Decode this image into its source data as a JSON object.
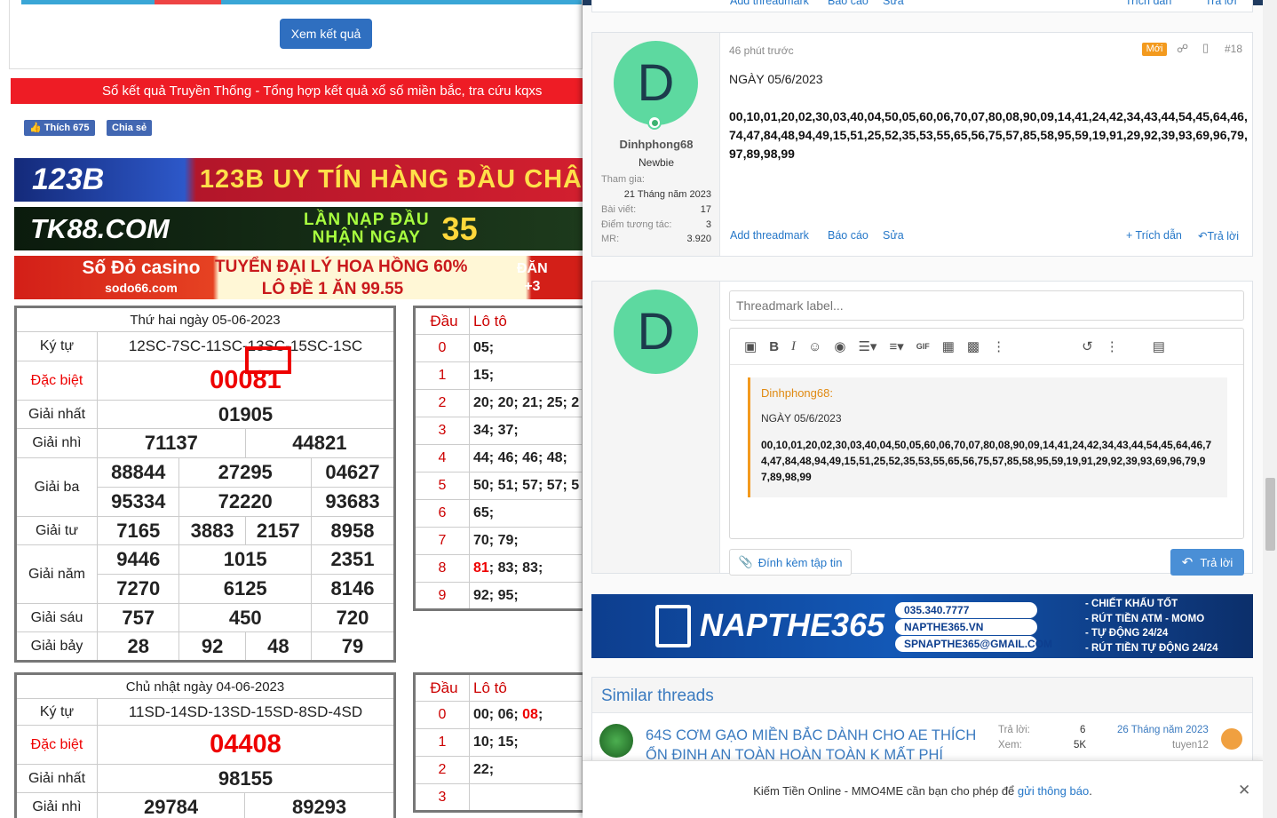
{
  "left": {
    "result_button": "Xem kết quả",
    "red_bar": "Sổ kết quả Truyền Thống - Tổng hợp kết quả xổ số miền bắc, tra cứu kqxs",
    "fb_like": "Thích 675",
    "fb_share": "Chia sẻ",
    "banners": {
      "b1_logo": "123B",
      "b1_text": "123B UY TÍN HÀNG ĐẦU CHÂ",
      "b2_logo": "TK88.COM",
      "b2_line1": "LẦN NẠP ĐẦU",
      "b2_line2": "NHẬN NGAY",
      "b2_big": "35",
      "b3_logo": "Số Đỏ casino",
      "b3_site": "sodo66.com",
      "b3_line1": "TUYỂN ĐẠI LÝ  HOA HỒNG 60%",
      "b3_line2": "LÔ ĐỀ  1 ĂN 99.55",
      "b3_corner1": "ĐĂN",
      "b3_corner2": "+3"
    },
    "tables": [
      {
        "header": "Thứ hai ngày 05-06-2023",
        "labels": {
          "ky_tu": "Ký tự",
          "dac_biet": "Đặc biệt",
          "g1": "Giải nhất",
          "g2": "Giải nhì",
          "g3": "Giải ba",
          "g4": "Giải tư",
          "g5": "Giải năm",
          "g6": "Giải sáu",
          "g7": "Giải bảy"
        },
        "ky_tu": "12SC-7SC-11SC-13SC-15SC-1SC",
        "dac_biet": "00081",
        "g1": "01905",
        "g2": [
          "71137",
          "44821"
        ],
        "g3": [
          "88844",
          "27295",
          "04627",
          "95334",
          "72220",
          "93683"
        ],
        "g4": [
          "7165",
          "3883",
          "2157",
          "8958"
        ],
        "g5": [
          "9446",
          "1015",
          "2351",
          "7270",
          "6125",
          "8146"
        ],
        "g6": [
          "757",
          "450",
          "720"
        ],
        "g7": [
          "28",
          "92",
          "48",
          "79"
        ]
      },
      {
        "header": "Chủ nhật ngày 04-06-2023",
        "labels": {
          "ky_tu": "Ký tự",
          "dac_biet": "Đặc biệt",
          "g1": "Giải nhất",
          "g2": "Giải nhì"
        },
        "ky_tu": "11SD-14SD-13SD-15SD-8SD-4SD",
        "dac_biet": "04408",
        "g1": "98155",
        "g2": [
          "29784",
          "89293"
        ]
      }
    ],
    "loto": [
      {
        "head_label": "Đầu",
        "loto_label": "Lô tô",
        "rows": [
          {
            "dau": "0",
            "pre": "",
            "hl": "",
            "rest": "05;"
          },
          {
            "dau": "1",
            "pre": "",
            "hl": "",
            "rest": "15;"
          },
          {
            "dau": "2",
            "pre": "",
            "hl": "",
            "rest": "20; 20; 21; 25; 2"
          },
          {
            "dau": "3",
            "pre": "",
            "hl": "",
            "rest": "34; 37;"
          },
          {
            "dau": "4",
            "pre": "",
            "hl": "",
            "rest": "44; 46; 46; 48;"
          },
          {
            "dau": "5",
            "pre": "",
            "hl": "",
            "rest": "50; 51; 57; 57; 5"
          },
          {
            "dau": "6",
            "pre": "",
            "hl": "",
            "rest": "65;"
          },
          {
            "dau": "7",
            "pre": "",
            "hl": "",
            "rest": "70; 79;"
          },
          {
            "dau": "8",
            "pre": "",
            "hl": "81",
            "rest": "; 83; 83;"
          },
          {
            "dau": "9",
            "pre": "",
            "hl": "",
            "rest": "92; 95;"
          }
        ]
      },
      {
        "head_label": "Đầu",
        "loto_label": "Lô tô",
        "rows": [
          {
            "dau": "0",
            "pre": "00; 06; ",
            "hl": "08",
            "rest": ";"
          },
          {
            "dau": "1",
            "pre": "",
            "hl": "",
            "rest": "10; 15;"
          },
          {
            "dau": "2",
            "pre": "",
            "hl": "",
            "rest": "22;"
          },
          {
            "dau": "3",
            "pre": "",
            "hl": "",
            "rest": ""
          }
        ]
      }
    ]
  },
  "forum": {
    "prev_actions": {
      "add": "Add threadmark",
      "report": "Báo cáo",
      "edit": "Sửa",
      "quote": "Trích dẫn",
      "reply": "Trả lời"
    },
    "post": {
      "avatar_letter": "D",
      "username": "Dinhphong68",
      "user_title": "Newbie",
      "joined_label": "Tham gia:",
      "joined": "21 Tháng năm 2023",
      "posts_label": "Bài viết:",
      "posts": "17",
      "points_label": "Điểm tương tác:",
      "points": "3",
      "mr_label": "MR:",
      "mr": "3.920",
      "time": "46 phút trước",
      "badge": "Mới",
      "number": "#18",
      "date_line": "NGÀY 05/6/2023",
      "numbers": "00,10,01,20,02,30,03,40,04,50,05,60,06,70,07,80,08,90,09,14,41,24,42,34,43,44,54,45,64,46,74,47,84,48,94,49,15,51,25,52,35,53,55,65,56,75,57,85,58,95,59,19,91,29,92,39,93,69,96,79,97,89,98,99",
      "add_threadmark": "Add threadmark",
      "report": "Báo cáo",
      "edit": "Sửa",
      "quote": "+ Trích dẫn",
      "reply": "Trả lời"
    },
    "editor": {
      "avatar_letter": "D",
      "threadmark_placeholder": "Threadmark label...",
      "quote_author": "Dinhphong68:",
      "quote_date": "NGÀY 05/6/2023",
      "quote_numbers": "00,10,01,20,02,30,03,40,04,50,05,60,06,70,07,80,08,90,09,14,41,24,42,34,43,44,54,45,64,46,74,47,84,48,94,49,15,51,25,52,35,53,55,65,56,75,57,85,58,95,59,19,91,29,92,39,93,69,96,79,97,89,98,99",
      "attach": "Đính kèm tập tin",
      "reply_button": "Trả lời"
    },
    "ad": {
      "brand": "NAPTHE365",
      "phone": "035.340.7777",
      "site": "NAPTHE365.VN",
      "email": "SPNAPTHE365@GMAIL.COM",
      "feat1": "- CHIẾT KHẤU TỐT",
      "feat2": "- RÚT TIỀN ATM - MOMO",
      "feat3": "- TỰ ĐỘNG 24/24",
      "feat4": "- RÚT TIỀN TỰ ĐỘNG 24/24"
    },
    "similar": {
      "heading": "Similar threads",
      "title": "64S CƠM GẠO MIỀN BẮC DÀNH CHO AE THÍCH ỔN ĐỊNH AN TOÀN HOÀN TOÀN K MẤT PHÍ",
      "replies_label": "Trả lời:",
      "replies": "6",
      "views_label": "Xem:",
      "views": "5K",
      "date": "26 Tháng năm 2023",
      "user": "tuyen12"
    },
    "notification": {
      "text": "Kiếm Tiền Online - MMO4ME cần bạn cho phép để ",
      "link": "gửi thông báo",
      "end": "."
    }
  },
  "colors": {
    "accent": "#2577c8",
    "badge": "#f39a1e",
    "red": "#ee1c25",
    "avatar": "#5dd9a0"
  }
}
